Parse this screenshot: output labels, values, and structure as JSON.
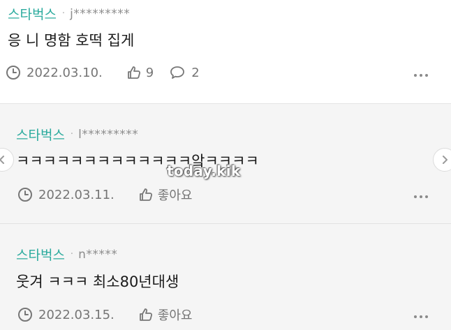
{
  "comments": [
    {
      "nickname": "스타벅스",
      "separator": "·",
      "user_id": "j*********",
      "text": "응 니 명함 호떡 집게",
      "date": "2022.03.10.",
      "likes": "9",
      "replies": "2"
    },
    {
      "nickname": "스타벅스",
      "separator": "·",
      "user_id": "l*********",
      "text": "ㅋㅋㅋㅋㅋㅋㅋㅋㅋㅋㅋㅋㅋ앜ㅋㅋㅋㅋ",
      "date": "2022.03.11.",
      "like_label": "좋아요"
    },
    {
      "nickname": "스타벅스",
      "separator": "·",
      "user_id": "n*****",
      "text": "웃겨 ㅋㅋㅋ 최소80년대생",
      "date": "2022.03.15.",
      "like_label": "좋아요"
    }
  ],
  "watermark": "today.kik",
  "icons": {
    "clock": "clock-icon",
    "thumbs_up": "thumbs-up-icon",
    "reply": "speech-bubble-icon",
    "more": "more-dots-icon",
    "prev": "chevron-left-icon",
    "next": "chevron-right-icon"
  },
  "colors": {
    "nickname": "#2cab9e",
    "meta_text": "#757575",
    "reply_bg": "#f5f5f5"
  }
}
